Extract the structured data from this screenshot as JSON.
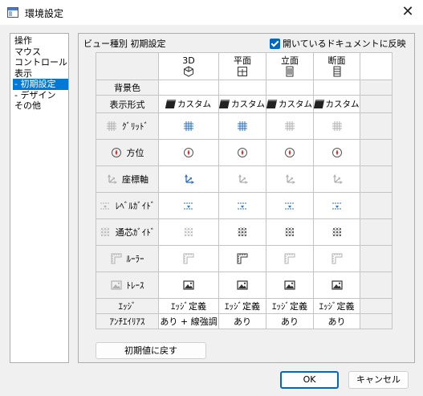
{
  "window": {
    "title": "環境設定",
    "close_glyph": "✕"
  },
  "nav": {
    "items": [
      {
        "label": "操作",
        "selected": false
      },
      {
        "label": "マウス",
        "selected": false
      },
      {
        "label": "コントロール",
        "selected": false
      },
      {
        "label": "表示",
        "selected": false
      },
      {
        "label": " - 初期設定",
        "selected": true
      },
      {
        "label": " - デザイン",
        "selected": false
      },
      {
        "label": "その他",
        "selected": false
      }
    ]
  },
  "panel": {
    "title": "ビュー種別  初期設定",
    "reflect_label": "開いているドキュメントに反映",
    "reflect_checked": true
  },
  "columns": [
    {
      "label": "3D",
      "icon": "cube-3d-icon"
    },
    {
      "label": "平面",
      "icon": "plan-view-icon"
    },
    {
      "label": "立面",
      "icon": "elevation-view-icon"
    },
    {
      "label": "断面",
      "icon": "section-view-icon"
    }
  ],
  "rows": {
    "background": {
      "label": "背景色"
    },
    "display_format": {
      "label": "表示形式",
      "values": [
        "カスタム",
        "カスタム",
        "カスタム",
        "カスタム"
      ]
    },
    "grid": {
      "label": "ｸﾞﾘｯﾄﾞ",
      "icon": "grid-icon",
      "active": [
        true,
        true,
        false,
        false
      ]
    },
    "bearing": {
      "label": "方位",
      "icon": "compass-icon",
      "active": [
        true,
        true,
        true,
        true
      ]
    },
    "axes": {
      "label": "座標軸",
      "icon": "coordinate-axes-icon",
      "active": [
        true,
        false,
        false,
        false
      ]
    },
    "level_guide": {
      "label": "ﾚﾍﾞﾙｶﾞｲﾄﾞ",
      "icon": "level-guide-icon",
      "active": [
        true,
        true,
        true,
        true
      ]
    },
    "center_guide": {
      "label": "通芯ｶﾞｲﾄﾞ",
      "icon": "center-guide-icon",
      "active": [
        false,
        true,
        true,
        true
      ]
    },
    "ruler": {
      "label": "ﾙｰﾗｰ",
      "icon": "ruler-icon",
      "active": [
        false,
        true,
        false,
        false
      ]
    },
    "trace": {
      "label": "ﾄﾚｰｽ",
      "icon": "trace-image-icon",
      "active": [
        true,
        true,
        true,
        true
      ]
    },
    "edge": {
      "label": "ｴｯｼﾞ",
      "values": [
        "ｴｯｼﾞ定義",
        "ｴｯｼﾞ定義",
        "ｴｯｼﾞ定義",
        "ｴｯｼﾞ定義"
      ]
    },
    "antialias": {
      "label": "ｱﾝﾁｴｲﾘｱｽ",
      "values": [
        "あり + 線強調",
        "あり",
        "あり",
        "あり"
      ]
    }
  },
  "buttons": {
    "reset": "初期値に戻す",
    "ok": "OK",
    "cancel": "キャンセル"
  },
  "colors": {
    "accent": "#0067c0",
    "active_icon": "#2b6fc2",
    "inactive_icon": "#b0b0b0",
    "selection": "#0078d7"
  }
}
